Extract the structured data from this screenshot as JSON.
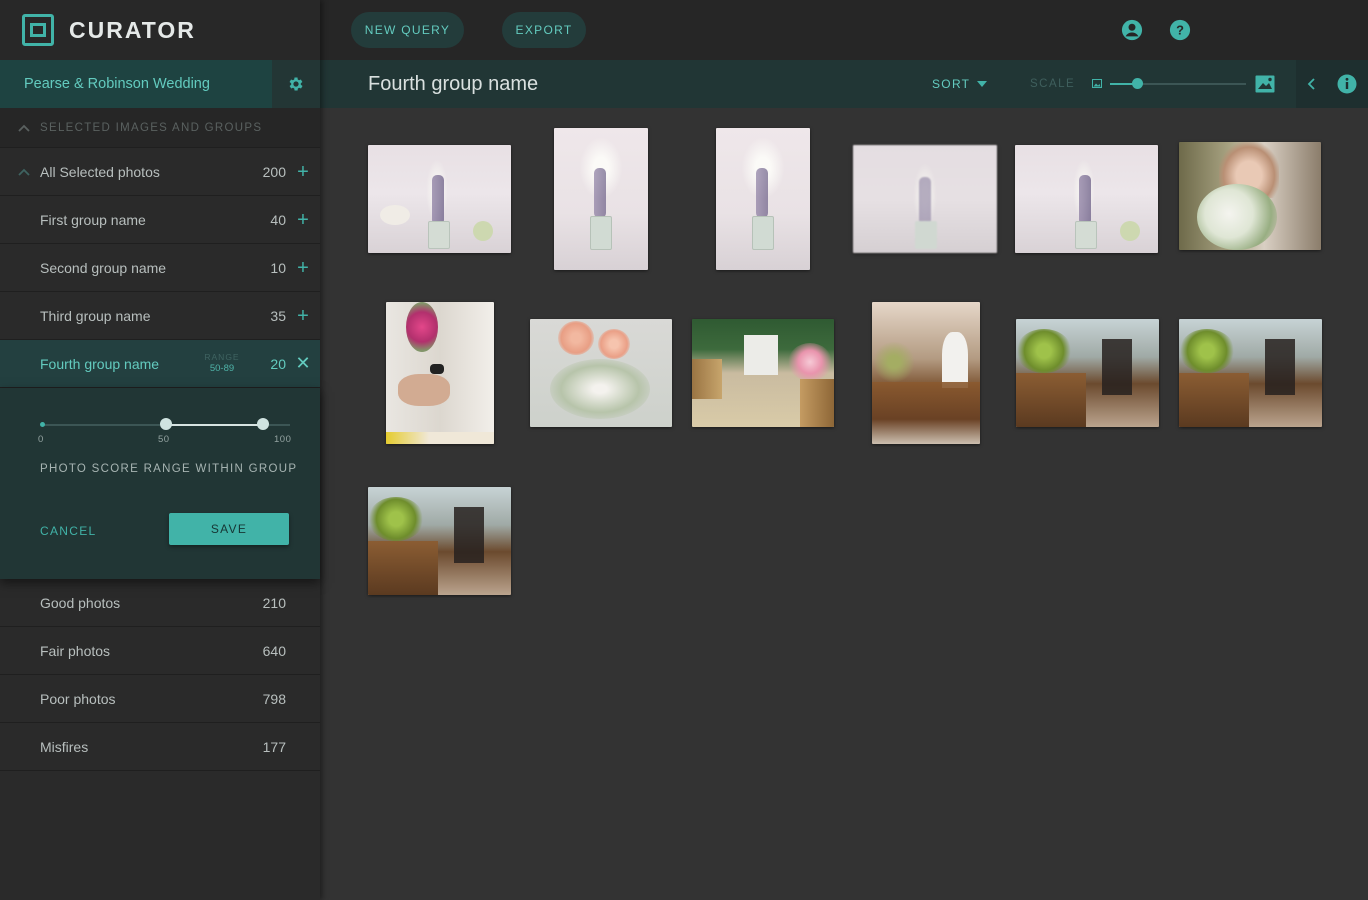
{
  "app": {
    "name": "CURATOR"
  },
  "project": {
    "name": "Pearse & Robinson Wedding"
  },
  "section": {
    "title": "SELECTED IMAGES AND GROUPS"
  },
  "all_selected": {
    "label": "All Selected photos",
    "count": "200"
  },
  "groups": [
    {
      "label": "First group name",
      "count": "40"
    },
    {
      "label": "Second group name",
      "count": "10"
    },
    {
      "label": "Third group name",
      "count": "35"
    }
  ],
  "active_group": {
    "label": "Fourth group name",
    "count": "20",
    "range_label": "RANGE",
    "range_value": "50-89"
  },
  "range_panel": {
    "tick_min": "0",
    "tick_mid": "50",
    "tick_max": "100",
    "low": 50,
    "high": 89,
    "caption": "PHOTO SCORE RANGE WITHIN GROUP",
    "cancel_label": "CANCEL",
    "save_label": "SAVE"
  },
  "quality_rows": [
    {
      "label": "Good photos",
      "count": "210"
    },
    {
      "label": "Fair photos",
      "count": "640"
    },
    {
      "label": "Poor photos",
      "count": "798"
    },
    {
      "label": "Misfires",
      "count": "177"
    }
  ],
  "toolbar": {
    "new_query_label": "NEW QUERY",
    "export_label": "EXPORT"
  },
  "view": {
    "title": "Fourth group name",
    "sort_label": "SORT",
    "scale_label": "SCALE",
    "scale_level": 0.2
  },
  "colors": {
    "accent": "#41b3a8",
    "accent_text": "#63cbbf",
    "active_bg": "#234040",
    "header_bg": "#213635",
    "canvas": "#333333"
  }
}
